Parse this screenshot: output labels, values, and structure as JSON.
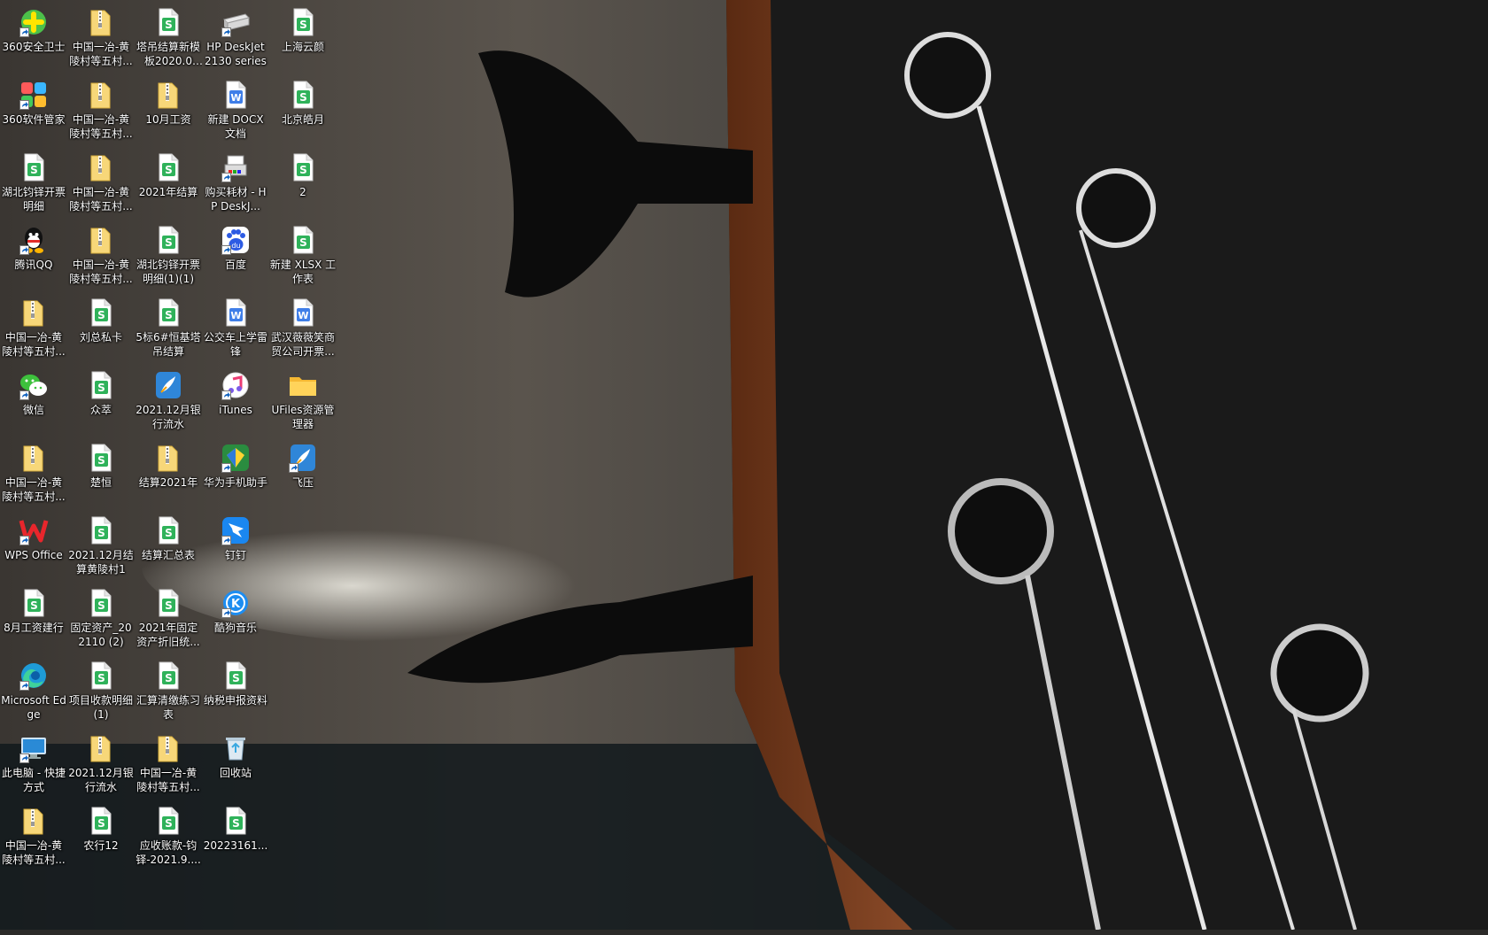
{
  "desktop": {
    "icons": [
      {
        "label": "360安全卫士",
        "type": "app-360",
        "shortcut": true
      },
      {
        "label": "360软件管家",
        "type": "app-360soft",
        "shortcut": true
      },
      {
        "label": "湖北钧铎开票明细",
        "type": "sheet",
        "shortcut": false
      },
      {
        "label": "腾讯QQ",
        "type": "qq",
        "shortcut": true
      },
      {
        "label": "中国一冶-黄陵村等五村...",
        "type": "folder-zip",
        "shortcut": false
      },
      {
        "label": "微信",
        "type": "wechat",
        "shortcut": true
      },
      {
        "label": "中国一冶-黄陵村等五村...",
        "type": "folder-zip",
        "shortcut": false
      },
      {
        "label": "WPS Office",
        "type": "wps",
        "shortcut": true
      },
      {
        "label": "8月工资建行",
        "type": "sheet",
        "shortcut": false
      },
      {
        "label": "Microsoft Edge",
        "type": "edge",
        "shortcut": true
      },
      {
        "label": "此电脑 - 快捷方式",
        "type": "computer",
        "shortcut": true
      },
      {
        "label": "中国一冶-黄陵村等五村...",
        "type": "folder-zip",
        "shortcut": false
      },
      {
        "label": "中国一冶-黄陵村等五村...",
        "type": "folder-zip",
        "shortcut": false
      },
      {
        "label": "中国一冶-黄陵村等五村...",
        "type": "folder-zip",
        "shortcut": false
      },
      {
        "label": "中国一冶-黄陵村等五村...",
        "type": "folder-zip",
        "shortcut": false
      },
      {
        "label": "中国一冶-黄陵村等五村...",
        "type": "folder-zip",
        "shortcut": false
      },
      {
        "label": "刘总私卡",
        "type": "sheet",
        "shortcut": false
      },
      {
        "label": "众萃",
        "type": "sheet",
        "shortcut": false
      },
      {
        "label": "楚恒",
        "type": "sheet",
        "shortcut": false
      },
      {
        "label": "2021.12月结算黄陵村1",
        "type": "sheet",
        "shortcut": false
      },
      {
        "label": "固定资产_202110 (2)",
        "type": "sheet",
        "shortcut": false
      },
      {
        "label": "项目收款明细(1)",
        "type": "sheet",
        "shortcut": false
      },
      {
        "label": "2021.12月银行流水",
        "type": "folder-zip",
        "shortcut": false
      },
      {
        "label": "农行12",
        "type": "sheet",
        "shortcut": false
      },
      {
        "label": "塔吊结算新模板2020.08....",
        "type": "sheet",
        "shortcut": false
      },
      {
        "label": "10月工资",
        "type": "folder-zip",
        "shortcut": false
      },
      {
        "label": "2021年结算",
        "type": "sheet",
        "shortcut": false
      },
      {
        "label": "湖北钧铎开票明细(1)(1)",
        "type": "sheet",
        "shortcut": false
      },
      {
        "label": "5标6#恒基塔吊结算",
        "type": "sheet",
        "shortcut": false
      },
      {
        "label": "2021.12月银行流水",
        "type": "feiya",
        "shortcut": false
      },
      {
        "label": "结算2021年",
        "type": "folder-zip",
        "shortcut": false
      },
      {
        "label": "结算汇总表",
        "type": "sheet",
        "shortcut": false
      },
      {
        "label": "2021年固定资产折旧统...",
        "type": "sheet",
        "shortcut": false
      },
      {
        "label": "汇算清缴练习表",
        "type": "sheet",
        "shortcut": false
      },
      {
        "label": "中国一冶-黄陵村等五村...",
        "type": "folder-zip",
        "shortcut": false
      },
      {
        "label": "应收账款-钧铎-2021.9....",
        "type": "sheet",
        "shortcut": false
      },
      {
        "label": "HP DeskJet 2130 series",
        "type": "printer",
        "shortcut": true
      },
      {
        "label": "新建 DOCX 文档",
        "type": "doc",
        "shortcut": false
      },
      {
        "label": "购买耗材 - HP DeskJ...",
        "type": "printer-color",
        "shortcut": true
      },
      {
        "label": "百度",
        "type": "baidu",
        "shortcut": true
      },
      {
        "label": "公交车上学雷锋",
        "type": "doc",
        "shortcut": false
      },
      {
        "label": "iTunes",
        "type": "itunes",
        "shortcut": true
      },
      {
        "label": "华为手机助手",
        "type": "huawei",
        "shortcut": true
      },
      {
        "label": "钉钉",
        "type": "dingtalk",
        "shortcut": true
      },
      {
        "label": "酷狗音乐",
        "type": "kugou",
        "shortcut": true
      },
      {
        "label": "纳税申报资料",
        "type": "sheet",
        "shortcut": false
      },
      {
        "label": "回收站",
        "type": "recycle",
        "shortcut": false
      },
      {
        "label": "20223161...",
        "type": "sheet",
        "shortcut": false
      },
      {
        "label": "上海云颜",
        "type": "sheet",
        "shortcut": false
      },
      {
        "label": "北京皓月",
        "type": "sheet",
        "shortcut": false
      },
      {
        "label": "2",
        "type": "sheet",
        "shortcut": false
      },
      {
        "label": "新建 XLSX 工作表",
        "type": "sheet",
        "shortcut": false
      },
      {
        "label": "武汉薇薇笑商贸公司开票...",
        "type": "doc",
        "shortcut": false
      },
      {
        "label": "UFiles资源管理器",
        "type": "folder",
        "shortcut": false
      },
      {
        "label": "飞压",
        "type": "feiya",
        "shortcut": true
      }
    ]
  }
}
